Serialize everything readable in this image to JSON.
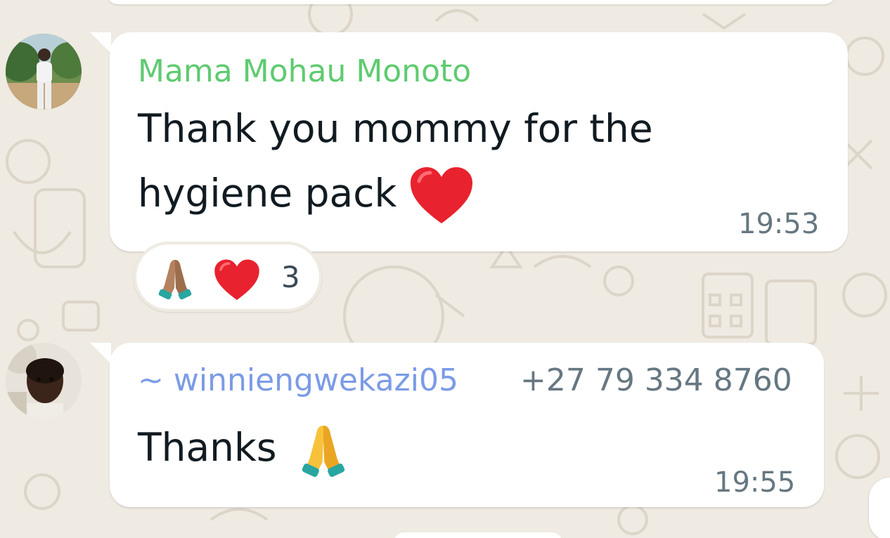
{
  "messages": [
    {
      "sender_name": "Mama Mohau Monoto",
      "sender_color": "#5ecb70",
      "text_line1": "Thank you mommy for the",
      "text_line2": "hygiene pack",
      "trailing_emoji": "red-heart",
      "time": "19:53",
      "reactions": {
        "emojis": [
          "folded-hands",
          "red-heart"
        ],
        "count": "3"
      }
    },
    {
      "sender_name": "~ winniengwekazi05",
      "sender_color": "#7b9be6",
      "sender_phone": "+27 79 334 8760",
      "text": "Thanks",
      "trailing_emoji": "folded-hands",
      "time": "19:55"
    }
  ],
  "colors": {
    "chat_background": "#efeae2",
    "bubble": "#ffffff",
    "timestamp": "#667781"
  }
}
